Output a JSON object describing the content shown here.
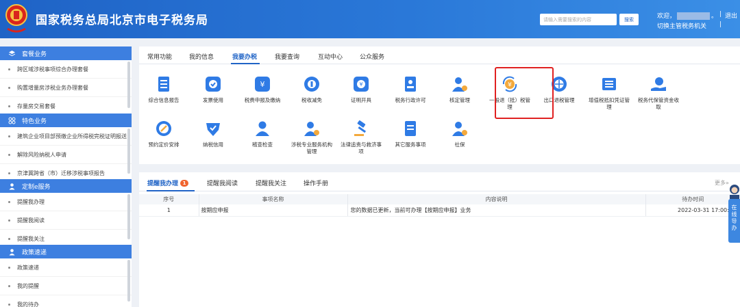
{
  "header": {
    "title": "国家税务总局北京市电子税务局",
    "search_placeholder": "请输入需要搜索的内容",
    "search_button": "搜索",
    "welcome": "欢迎，",
    "welcome_tail": "。",
    "switch_org": "切换主管税务机关",
    "logout": "退出",
    "separator": "|"
  },
  "sidebar": {
    "groups": [
      {
        "title": "套餐业务",
        "items": [
          "跨区域涉税事项综合办理套餐",
          "购置增量房涉税业务办理套餐",
          "存量房交易套餐"
        ]
      },
      {
        "title": "特色业务",
        "items": [
          "建筑企业项目部预缴企业所得税完税证明报送",
          "解除风险纳税人申请",
          "京津冀跨省（市）迁移涉税事项报告"
        ]
      },
      {
        "title": "定制e服务",
        "items": [
          "提醒我办理",
          "提醒我阅读",
          "提醒我关注"
        ]
      },
      {
        "title": "政策速递",
        "items": [
          "政策速递",
          "我的提醒",
          "我的待办"
        ]
      }
    ]
  },
  "main_tabs": [
    "常用功能",
    "我的信息",
    "我要办税",
    "我要查询",
    "互动中心",
    "公众服务"
  ],
  "active_main_tab": "我要办税",
  "services": [
    {
      "label": "综合信息报告",
      "icon": "document-list-icon"
    },
    {
      "label": "发票使用",
      "icon": "invoice-check-icon"
    },
    {
      "label": "税费申报及缴纳",
      "icon": "tax-declare-icon"
    },
    {
      "label": "税收减免",
      "icon": "tax-reduction-icon"
    },
    {
      "label": "证明开具",
      "icon": "certificate-icon"
    },
    {
      "label": "税务行政许可",
      "icon": "license-icon"
    },
    {
      "label": "核定管理",
      "icon": "verify-person-icon"
    },
    {
      "label": "一般退（抵）税管理",
      "icon": "tax-refund-icon"
    },
    {
      "label": "出口退税管理",
      "icon": "export-refund-icon"
    },
    {
      "label": "增值税抵扣凭证管理",
      "icon": "vat-voucher-icon"
    },
    {
      "label": "税务代保管资金收取",
      "icon": "funds-custody-icon"
    },
    {
      "label": "预约定价安排",
      "icon": "pricing-compass-icon"
    },
    {
      "label": "纳税信用",
      "icon": "credit-icon"
    },
    {
      "label": "稽查检查",
      "icon": "inspection-icon"
    },
    {
      "label": "涉税专业服务机构管理",
      "icon": "agency-manage-icon"
    },
    {
      "label": "法律追责与救济事项",
      "icon": "legal-gavel-icon"
    },
    {
      "label": "其它服务事项",
      "icon": "other-services-icon"
    },
    {
      "label": "社保",
      "icon": "social-security-icon"
    }
  ],
  "highlighted_service": "一般退（抵）税管理",
  "sub_tabs": [
    {
      "label": "提醒我办理",
      "badge": "1"
    },
    {
      "label": "提醒我阅读"
    },
    {
      "label": "提醒我关注"
    },
    {
      "label": "操作手册"
    }
  ],
  "more_link": "更多»",
  "table": {
    "columns": [
      "序号",
      "事项名称",
      "内容说明",
      "待办时间"
    ],
    "rows": [
      [
        "1",
        "按期应申报",
        "您的数据已更新，当前可办理【按期应申报】业务",
        "2022-03-31 17:00:58"
      ]
    ]
  },
  "guide_label": [
    "在",
    "线",
    "导",
    "办"
  ],
  "colors": {
    "brand_blue": "#1f63c6",
    "sidebar_head": "#3d7fe0",
    "badge_orange": "#f0642e",
    "highlight_red": "#e02020",
    "icon_primary": "#2f7be5"
  }
}
